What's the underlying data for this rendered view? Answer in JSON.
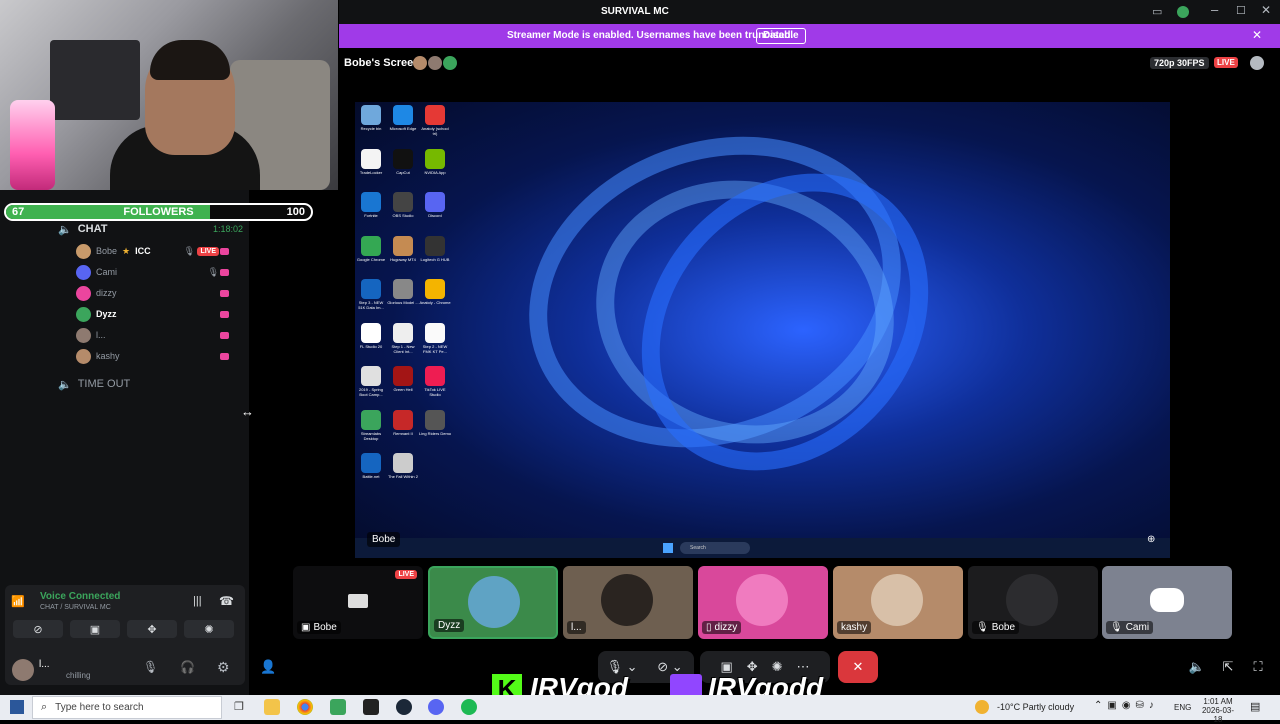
{
  "window": {
    "title": "SURVIVAL MC"
  },
  "banner": {
    "text": "Streamer Mode is enabled. Usernames have been truncated.",
    "disable_label": "Disable"
  },
  "stream": {
    "title": "Bobe's Screen",
    "quality": "720p 30FPS",
    "live": "LIVE",
    "presenter_label": "Bobe"
  },
  "followers": {
    "current": "67",
    "label": "FOLLOWERS",
    "goal": "100",
    "progress": 0.67
  },
  "sidebar": {
    "chat_channel": {
      "name": "CHAT",
      "timer": "1:18:02"
    },
    "users": [
      {
        "name": "Bobe",
        "tag": "ICC",
        "live": "LIVE",
        "color": "#c89a6a"
      },
      {
        "name": "Cami",
        "color": "#5865f2"
      },
      {
        "name": "dizzy",
        "color": "#eb459e"
      },
      {
        "name": "Dyzz",
        "color": "#3ba55c"
      },
      {
        "name": "l...",
        "color": "#8e7a70"
      },
      {
        "name": "kashy",
        "color": "#b58b6a"
      }
    ],
    "timeout_channel": {
      "name": "TIME OUT"
    }
  },
  "voice": {
    "status": "Voice Connected",
    "location": "CHAT / SURVIVAL MC",
    "user_name": "l...",
    "user_status": "chilling"
  },
  "desktop_icons": [
    [
      "Recycle bin",
      "Microsoft Edge",
      "Anatoly (school tri)"
    ],
    [
      "TradeLocker",
      "CapCut",
      "NVIDIA App"
    ],
    [
      "Fortnite",
      "OBS Studio",
      "Discord"
    ],
    [
      "Google Chrome",
      "Hugoway MT4",
      "Logitech G HUB"
    ],
    [
      "Step 3 - NEW 51K Data Im...",
      "Glorious Model ...",
      "Anatoly - Chrome"
    ],
    [
      "FL Studio 20",
      "Step 1 - New Client Int...",
      "Step 2 - NEW FMK KT Pe..."
    ],
    [
      "2019 - Spring Boot Camp...",
      "Green Hell",
      "TikTok LIVE Studio"
    ],
    [
      "Streamlabs Desktop",
      "Remnant II",
      "Ling Riders Demo"
    ],
    [
      "Battle.net",
      "The Fall Within 2"
    ]
  ],
  "desktop_search": "Search",
  "tiles": [
    {
      "name": "Bobe",
      "live": "LIVE"
    },
    {
      "name": "Dyzz"
    },
    {
      "name": "l..."
    },
    {
      "name": "dizzy"
    },
    {
      "name": "kashy"
    },
    {
      "name": "Bobe"
    },
    {
      "name": "Cami"
    }
  ],
  "overlay": {
    "kick_name": "IRVgod",
    "twitch_name": "IRVgodd"
  },
  "taskbar": {
    "search_placeholder": "Type here to search",
    "weather": "-10°C  Partly cloudy",
    "lang": "ENG",
    "time": "1:01 AM",
    "date": "2026-03-18"
  },
  "colors": {
    "accent": "#a03ae8",
    "live": "#ed4245",
    "green": "#3ba55c",
    "pink": "#eb459e"
  }
}
